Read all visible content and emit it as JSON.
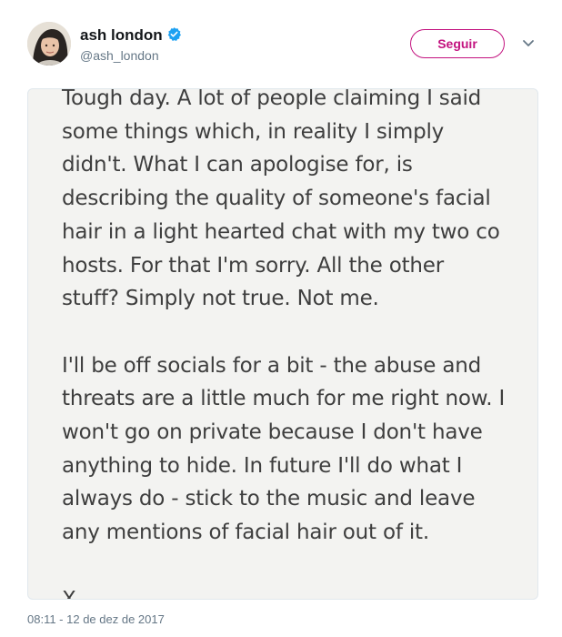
{
  "user": {
    "display_name": "ash london",
    "handle": "@ash_london",
    "verified": true,
    "avatar": "profile-photo"
  },
  "actions": {
    "follow_label": "Seguir",
    "menu_icon": "chevron-down-icon"
  },
  "tweet": {
    "image_lines": [
      "Tough day. A lot of people claiming I said",
      "some things which, in reality I simply",
      "didn't. What I can apologise for, is",
      "describing the quality of someone's facial",
      "hair in a light hearted chat with my two co",
      "hosts. For that I'm sorry. All the other",
      "stuff? Simply not true. Not me.",
      "",
      "I'll be off socials for a bit - the abuse and",
      "threats are a little much for me right now. I",
      "won't go on private because I don't have",
      "anything to hide. In future I'll do what I",
      "always do - stick to the music and leave",
      "any mentions of facial hair out of it.",
      "",
      "X"
    ],
    "timestamp": "08:11 - 12 de dez de 2017"
  },
  "colors": {
    "accent": "#c3137f",
    "verified": "#1da1f2",
    "text_primary": "#14171a",
    "text_secondary": "#657786",
    "note_background": "#f3f3f1",
    "note_text": "#3e3e3e"
  }
}
